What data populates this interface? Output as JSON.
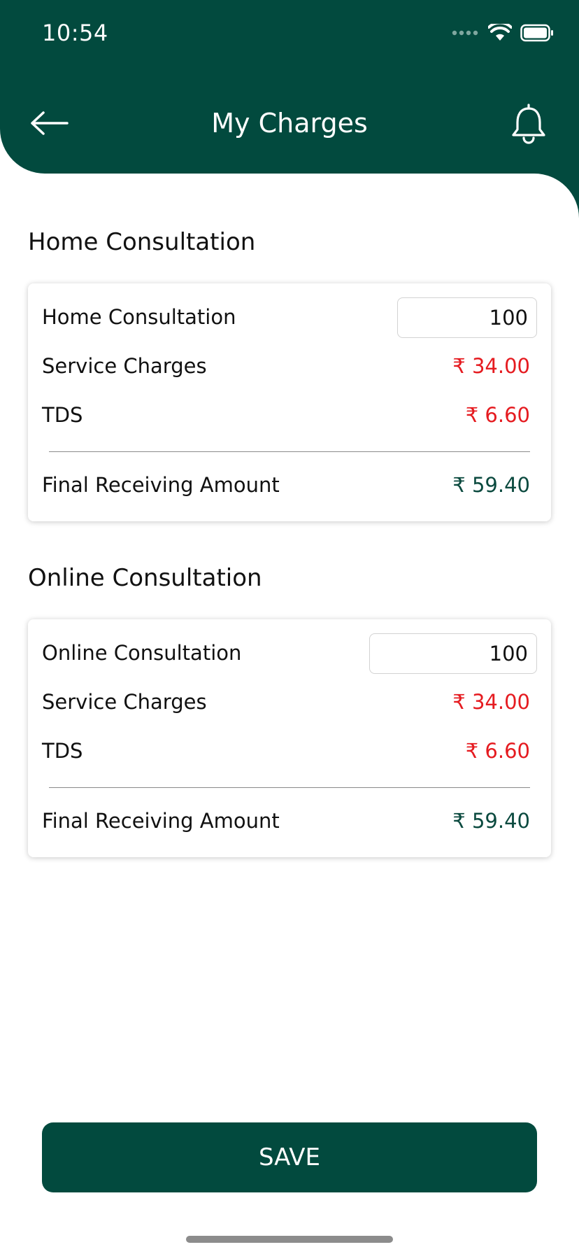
{
  "status_bar": {
    "time": "10:54",
    "signal_icon": "signal-dots-icon",
    "wifi_icon": "wifi-icon",
    "battery_icon": "battery-icon"
  },
  "header": {
    "title": "My Charges",
    "back_icon": "arrow-left-icon",
    "bell_icon": "bell-icon"
  },
  "colors": {
    "primary": "#024a3e",
    "negative_amount": "#e51b20",
    "final_amount": "#0b4a3f"
  },
  "sections": [
    {
      "title": "Home Consultation",
      "fee_label": "Home Consultation",
      "fee_value": "100",
      "service_label": "Service Charges",
      "service_value": "₹ 34.00",
      "tds_label": "TDS",
      "tds_value": "₹ 6.60",
      "final_label": "Final Receiving Amount",
      "final_value": "₹ 59.40"
    },
    {
      "title": "Online Consultation",
      "fee_label": "Online Consultation",
      "fee_value": "100",
      "service_label": "Service Charges",
      "service_value": "₹ 34.00",
      "tds_label": "TDS",
      "tds_value": "₹ 6.60",
      "final_label": "Final Receiving Amount",
      "final_value": "₹ 59.40"
    }
  ],
  "save_button": {
    "label": "SAVE"
  }
}
